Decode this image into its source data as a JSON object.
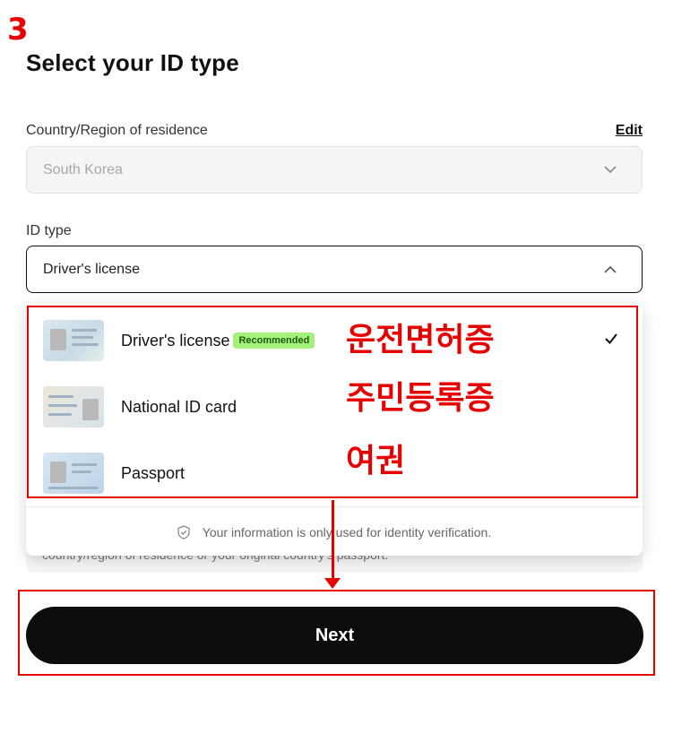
{
  "annotation": {
    "step_number": "3",
    "korean_labels": [
      "운전면허증",
      "주민등록증",
      "여권"
    ]
  },
  "page": {
    "title": "Select your ID type"
  },
  "country_field": {
    "label": "Country/Region of residence",
    "edit_label": "Edit",
    "value": "South Korea"
  },
  "id_type_field": {
    "label": "ID type",
    "value": "Driver's license"
  },
  "dropdown": {
    "options": [
      {
        "label": "Driver's license",
        "badge": "Recommended",
        "selected": true
      },
      {
        "label": "National ID card"
      },
      {
        "label": "Passport"
      }
    ],
    "footer_text": "Your information is only used for identity verification."
  },
  "info": {
    "text": "country/region of residence or your original country's passport."
  },
  "next_button": {
    "label": "Next"
  },
  "colors": {
    "annotation_red": "#e60000",
    "badge_green": "#a4f07a",
    "button_black": "#0d0d0d"
  }
}
